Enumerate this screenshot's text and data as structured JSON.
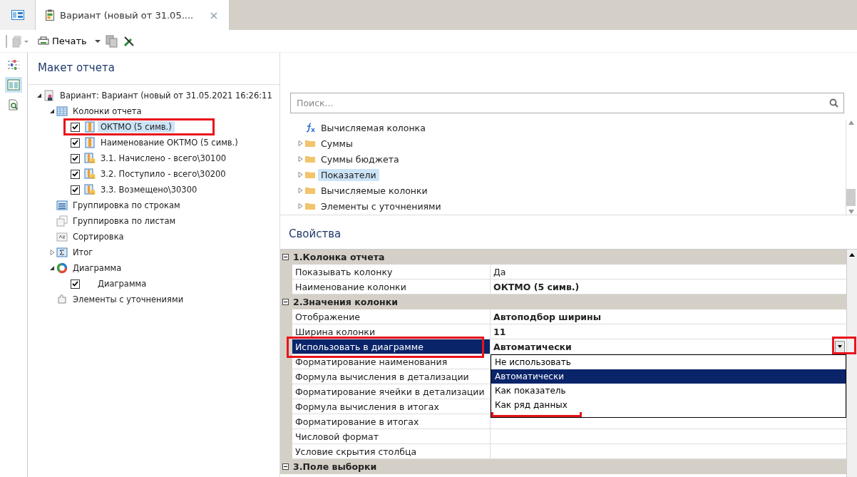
{
  "tabs": [
    {
      "kind": "home",
      "selected": false
    },
    {
      "kind": "document",
      "title": "Вариант (новый от 31.05....",
      "close": "×",
      "selected": true
    }
  ],
  "toolbar": {
    "print": "Печать"
  },
  "side_icons": [
    {
      "kind": "filter",
      "selected": false
    },
    {
      "kind": "layout",
      "selected": true
    },
    {
      "kind": "preview",
      "selected": false
    }
  ],
  "layout_title": "Макет отчета",
  "tree": [
    {
      "label": "Вариант: Вариант (новый от 31.05.2021 16:26:11",
      "kind": "variant",
      "expanded": true,
      "children": [
        {
          "label": "Колонки отчета",
          "kind": "columns",
          "expanded": true,
          "children": [
            {
              "label": "ОКТМО (5 симв.)",
              "kind": "column",
              "checked": true,
              "selected": true,
              "highlight": true
            },
            {
              "label": "Наименование ОКТМО (5 симв.)",
              "kind": "column",
              "checked": true,
              "selected": false
            },
            {
              "label": "3.1. Начислено - всего\\30100",
              "kind": "measure",
              "checked": true,
              "selected": false
            },
            {
              "label": "3.2. Поступило - всего\\30200",
              "kind": "measure",
              "checked": true,
              "selected": false
            },
            {
              "label": "3.3. Возмещено\\30300",
              "kind": "measure",
              "checked": true,
              "selected": false
            }
          ]
        },
        {
          "label": "Группировка по строкам",
          "kind": "rows",
          "selected": false
        },
        {
          "label": "Группировка по листам",
          "kind": "sheets",
          "selected": false
        },
        {
          "label": "Сортировка",
          "kind": "sort",
          "selected": false
        },
        {
          "label": "Итог",
          "kind": "total",
          "expanded": false,
          "selected": false
        },
        {
          "label": "Диаграмма",
          "kind": "chart",
          "expanded": true,
          "children": [
            {
              "label": "Диаграмма",
              "checked": true,
              "selected": false
            }
          ]
        },
        {
          "label": "Элементы с уточнениями",
          "kind": "refine",
          "selected": false
        }
      ]
    }
  ],
  "search": {
    "placeholder": "Поиск..."
  },
  "fields": [
    {
      "label": "Вычисляемая колонка",
      "kind": "formula",
      "selected": false
    },
    {
      "label": "Суммы",
      "kind": "folder",
      "expanded": false,
      "selected": false
    },
    {
      "label": "Суммы бюджета",
      "kind": "folder",
      "expanded": false,
      "selected": false
    },
    {
      "label": "Показатели",
      "kind": "folder",
      "expanded": false,
      "selected": true
    },
    {
      "label": "Вычисляемые колонки",
      "kind": "folder",
      "expanded": false,
      "selected": false
    },
    {
      "label": "Элементы с уточнениями",
      "kind": "folder",
      "expanded": false,
      "selected": false
    }
  ],
  "properties_title": "Свойства",
  "property_groups": [
    {
      "title": "1.Колонка отчета",
      "expanded": true,
      "rows": [
        {
          "name": "Показывать колонку",
          "value": "Да",
          "modified": false,
          "selected": false
        },
        {
          "name": "Наименование колонки",
          "value": "ОКТМО (5 симв.)",
          "modified": true,
          "selected": false
        }
      ]
    },
    {
      "title": "2.Значения колонки",
      "expanded": true,
      "rows": [
        {
          "name": "Отображение",
          "value": "Автоподбор ширины",
          "modified": true,
          "selected": false
        },
        {
          "name": "Ширина колонки",
          "value": "11",
          "modified": true,
          "selected": false
        },
        {
          "name": "Использовать в диаграмме",
          "value": "Автоматически",
          "modified": true,
          "selected": true,
          "highlight": true,
          "options": [
            {
              "label": "Не использовать",
              "selected": false
            },
            {
              "label": "Автоматически",
              "selected": true
            },
            {
              "label": "Как показатель",
              "selected": false
            },
            {
              "label": "Как ряд данных",
              "selected": false
            }
          ]
        },
        {
          "name": "Форматирование наименования",
          "selected": false
        },
        {
          "name": "Формула вычисления в детализации",
          "selected": false
        },
        {
          "name": "Форматирование ячейки в детализации",
          "selected": false
        },
        {
          "name": "Формула вычисления в итогах",
          "selected": false
        },
        {
          "name": "Форматирование в итогах",
          "selected": false
        },
        {
          "name": "Числовой формат",
          "selected": false
        },
        {
          "name": "Условие скрытия столбца",
          "selected": false
        }
      ]
    },
    {
      "title": "3.Поле выборки",
      "expanded": true
    }
  ]
}
